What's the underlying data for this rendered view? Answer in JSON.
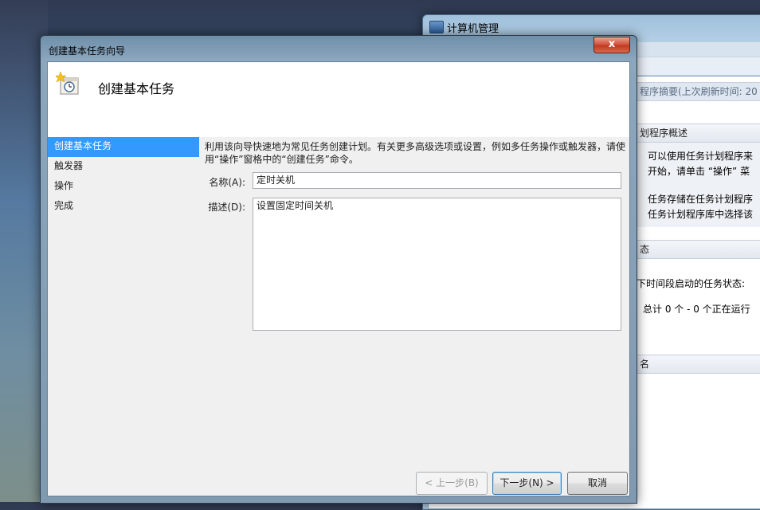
{
  "background_window": {
    "title": "计算机管理",
    "summary_header": "程序摘要(上次刷新时间: 20",
    "overview_header": "划程序概述",
    "overview_line1": "可以使用任务计划程序来",
    "overview_line2": "开始，请单击 “操作” 菜",
    "overview_line3": "任务存储在任务计划程序",
    "overview_line4": "任务计划程序库中选择该",
    "status_header": "态",
    "status_desc": "下时间段启动的任务状态:",
    "status_total": "总计 0 个 - 0 个正在运行",
    "name_header": "名"
  },
  "dialog": {
    "title": "创建基本任务向导",
    "close_label": "x",
    "header_title": "创建基本任务",
    "nav": [
      "创建基本任务",
      "触发器",
      "操作",
      "完成"
    ],
    "intro": "利用该向导快速地为常见任务创建计划。有关更多高级选项或设置，例如多任务操作或触发器，请使用“操作”窗格中的“创建任务”命令。",
    "name_label": "名称(A):",
    "name_value": "定时关机",
    "desc_label": "描述(D):",
    "desc_value": "设置固定时间关机",
    "back_button": "< 上一步(B)",
    "next_button": "下一步(N) >",
    "cancel_button": "取消"
  }
}
